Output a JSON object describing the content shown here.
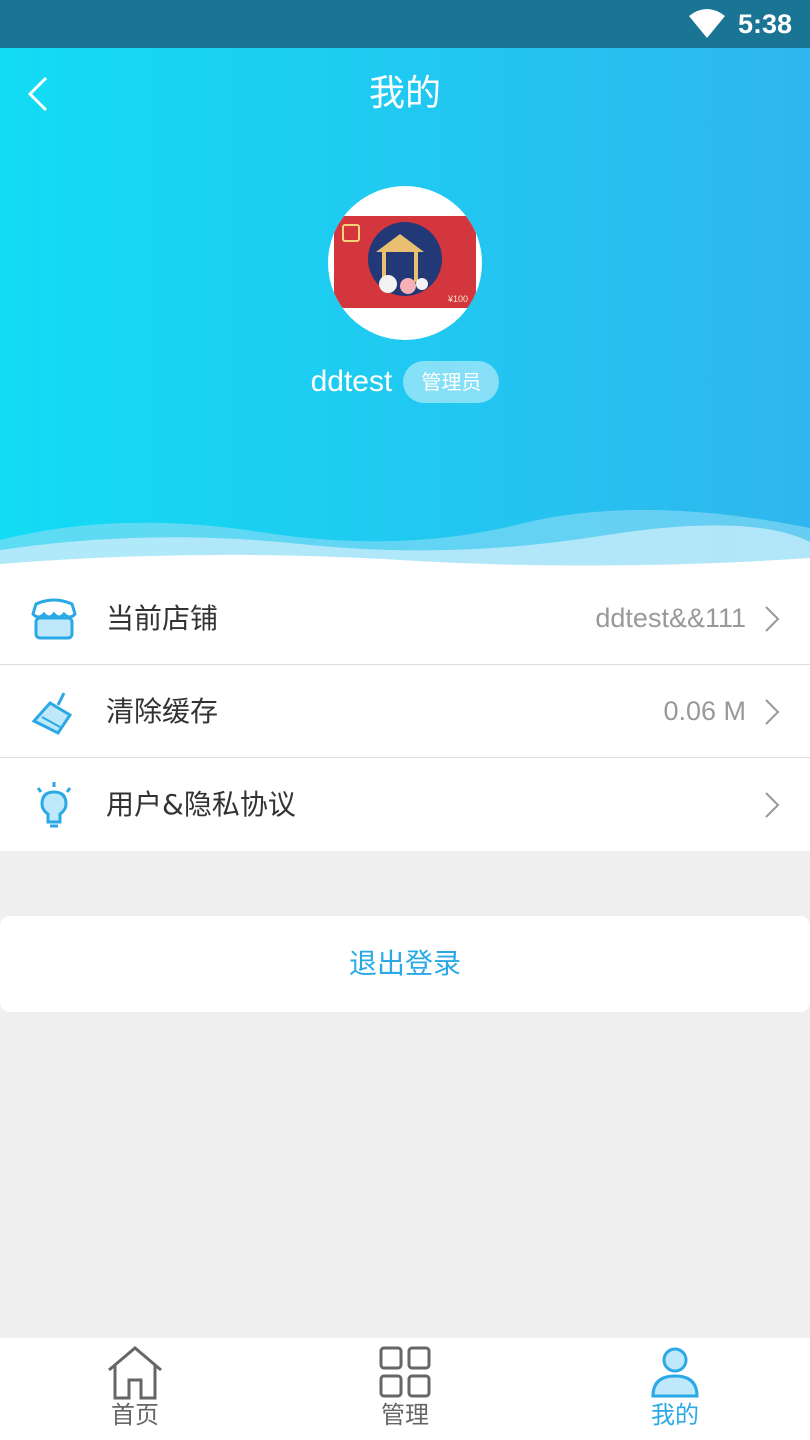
{
  "status_bar": {
    "time": "5:38"
  },
  "header": {
    "title": "我的"
  },
  "profile": {
    "username": "ddtest",
    "role": "管理员",
    "avatar_card_price": "¥100"
  },
  "menu": [
    {
      "label": "当前店铺",
      "value": "ddtest&&111",
      "icon": "store-icon"
    },
    {
      "label": "清除缓存",
      "value": "0.06 M",
      "icon": "broom-icon"
    },
    {
      "label": "用户&隐私协议",
      "value": "",
      "icon": "lightbulb-icon"
    }
  ],
  "logout": {
    "label": "退出登录"
  },
  "tabbar": {
    "items": [
      {
        "label": "首页",
        "icon": "home-icon",
        "active": false
      },
      {
        "label": "管理",
        "icon": "grid-icon",
        "active": false
      },
      {
        "label": "我的",
        "icon": "user-icon",
        "active": true
      }
    ]
  },
  "colors": {
    "accent": "#2aa9e6",
    "header_start": "#12dcf4",
    "header_end": "#2fb6ee",
    "status_bar": "#1a7494"
  }
}
